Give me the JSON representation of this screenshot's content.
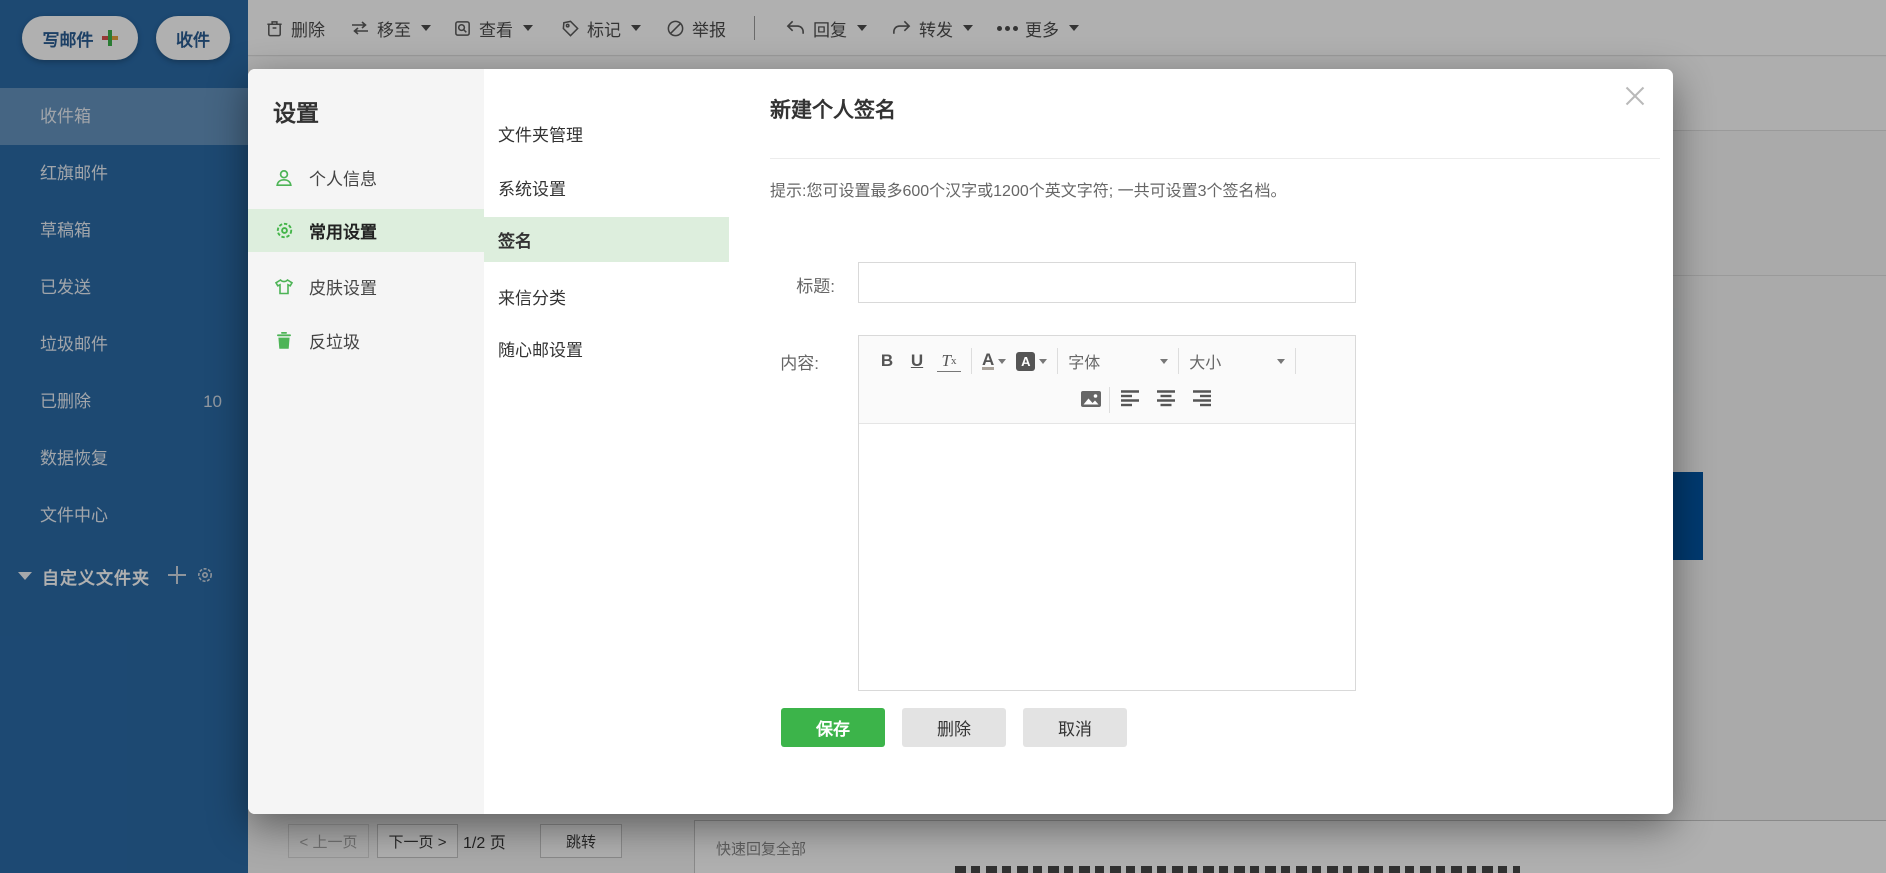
{
  "colors": {
    "sidebar_blue": "#2a6aa6",
    "accent_green": "#44b549",
    "highlight_green": "#ddeedd",
    "save_green": "#3cb44a",
    "right_blue_block": "#0054a2"
  },
  "sidebar": {
    "compose_label": "写邮件",
    "receive_label": "收件",
    "folders": [
      {
        "label": "收件箱",
        "active": true
      },
      {
        "label": "红旗邮件"
      },
      {
        "label": "草稿箱"
      },
      {
        "label": "已发送"
      },
      {
        "label": "垃圾邮件"
      },
      {
        "label": "已删除",
        "count": "10"
      },
      {
        "label": "数据恢复"
      },
      {
        "label": "文件中心"
      }
    ],
    "custom_folder_label": "自定义文件夹"
  },
  "toolbar": {
    "items": [
      {
        "label": "删除",
        "icon": "trash-icon",
        "dropdown": false
      },
      {
        "label": "移至",
        "icon": "move-icon",
        "dropdown": true
      },
      {
        "label": "查看",
        "icon": "view-icon",
        "dropdown": true
      },
      {
        "label": "标记",
        "icon": "tag-icon",
        "dropdown": true
      },
      {
        "label": "举报",
        "icon": "report-icon",
        "dropdown": false
      },
      {
        "label": "回复",
        "icon": "reply-icon",
        "dropdown": true
      },
      {
        "label": "转发",
        "icon": "forward-icon",
        "dropdown": true
      },
      {
        "label": "更多",
        "icon": "more-dots-icon",
        "dropdown": true
      }
    ]
  },
  "settings": {
    "title": "设置",
    "nav": [
      {
        "label": "个人信息",
        "icon": "person-icon",
        "active": false
      },
      {
        "label": "常用设置",
        "icon": "gear-flower-icon",
        "active": true
      },
      {
        "label": "皮肤设置",
        "icon": "tshirt-icon",
        "active": false
      },
      {
        "label": "反垃圾",
        "icon": "trash-icon",
        "active": false
      }
    ],
    "subnav": [
      {
        "label": "文件夹管理",
        "active": false
      },
      {
        "label": "系统设置",
        "active": false
      },
      {
        "label": "签名",
        "active": true
      },
      {
        "label": "来信分类",
        "active": false
      },
      {
        "label": "随心邮设置",
        "active": false
      }
    ]
  },
  "signature_panel": {
    "title": "新建个人签名",
    "tip": "提示:您可设置最多600个汉字或1200个英文字符; 一共可设置3个签名档。",
    "title_label": "标题:",
    "content_label": "内容:",
    "title_value": "",
    "editor": {
      "bold": "B",
      "underline": "U",
      "clear_format": "T",
      "clear_format_sub": "x",
      "font_color": "A",
      "bg_color": "A",
      "font_label": "字体",
      "size_label": "大小"
    },
    "buttons": {
      "save": "保存",
      "delete": "删除",
      "cancel": "取消"
    }
  },
  "pagination": {
    "prev": "< 上一页",
    "next": "下一页 >",
    "page": "1/2 页",
    "jump": "跳转"
  },
  "quick_reply_label": "快速回复全部"
}
